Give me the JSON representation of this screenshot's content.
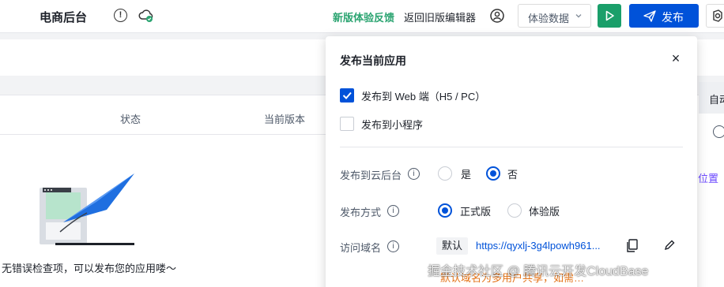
{
  "header": {
    "app_title": "电商后台",
    "feedback_label": "新版体验反馈",
    "back_label": "返回旧版编辑器",
    "mode_select_value": "体验数据",
    "publish_label": "发布",
    "info_glyph": "!",
    "icons": [
      "info-icon",
      "cloud-check-icon",
      "user-icon",
      "chevron-down-icon",
      "play-icon",
      "send-icon",
      "settings-icon"
    ],
    "colors": {
      "brand": "#0052d9",
      "run": "#1a9f6a",
      "feedback": "#2ba471"
    }
  },
  "table": {
    "columns": [
      "状态",
      "当前版本"
    ],
    "empty_text": "无错误检查项，可以发布您的应用喽～"
  },
  "right_edge": {
    "auto_label": "自动",
    "position_label": "位置"
  },
  "dialog": {
    "title": "发布当前应用",
    "close_glyph": "×",
    "targets": [
      {
        "label": "发布到 Web 端（H5 / PC）",
        "checked": true
      },
      {
        "label": "发布到小程序",
        "checked": false
      }
    ],
    "cloud_admin": {
      "label": "发布到云后台",
      "options": [
        "是",
        "否"
      ],
      "selected": "否"
    },
    "publish_mode": {
      "label": "发布方式",
      "options": [
        "正式版",
        "体验版"
      ],
      "selected": "正式版"
    },
    "domain": {
      "label": "访问域名",
      "tag": "默认",
      "url": "https://qyxlj-3g4lpowh961..."
    },
    "note": "默认域名为多用户共享，如需…"
  },
  "watermark": "掘金技术社区 @ 腾讯云开发CloudBase"
}
